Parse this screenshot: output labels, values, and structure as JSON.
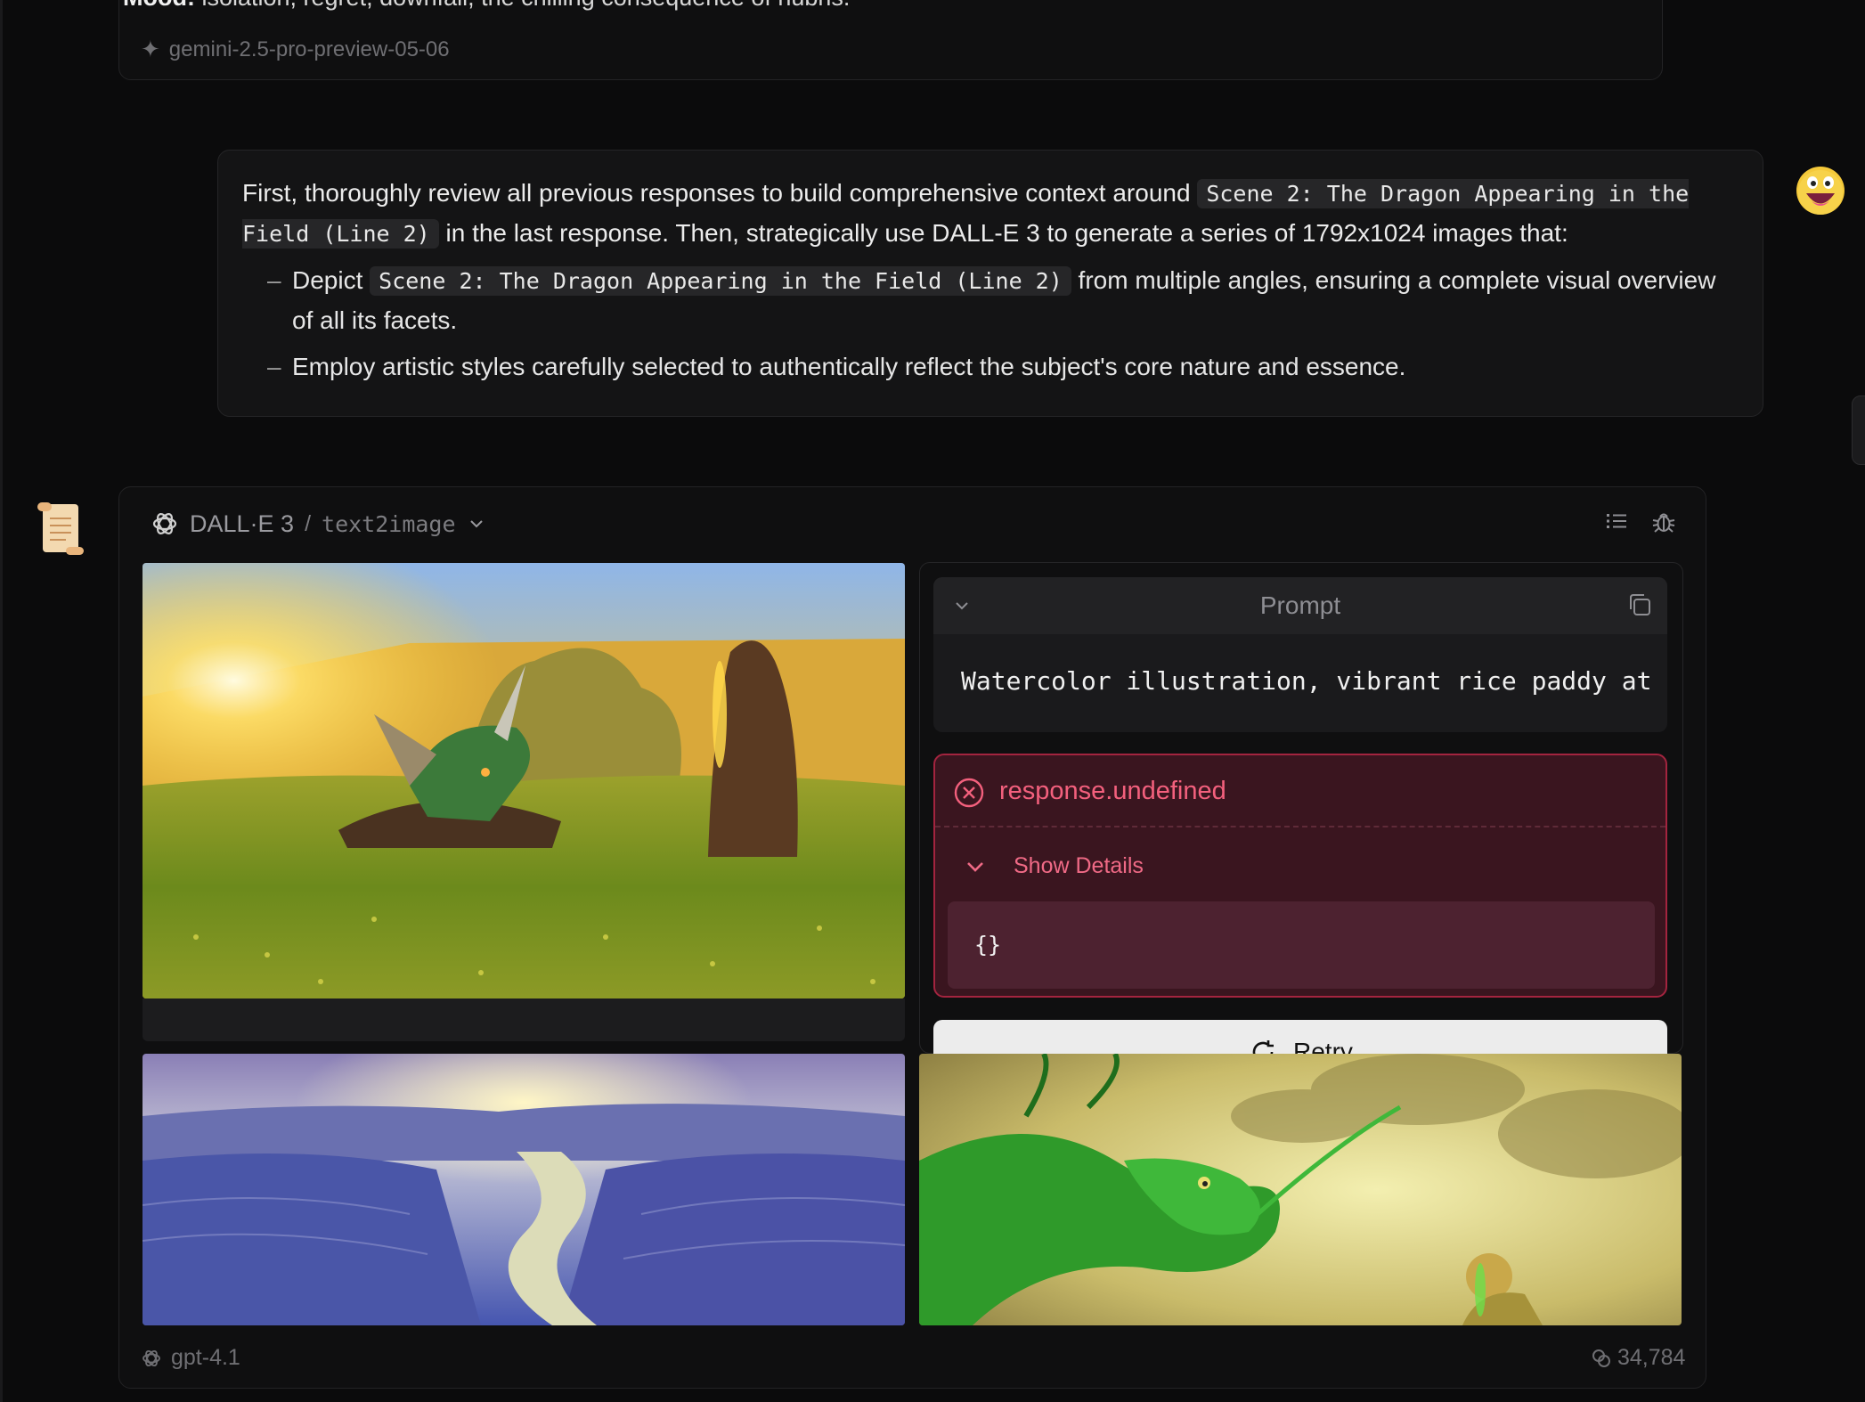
{
  "previous_message": {
    "text_bold": "Mood:",
    "text": " isolation, regret, downfall, the chilling consequence of hubris.",
    "model": "gemini-2.5-pro-preview-05-06"
  },
  "user_message": {
    "p1": "First, thoroughly review all previous responses to build comprehensive context around ",
    "code1": "Scene 2: The Dragon Appearing in the Field (Line 2)",
    "p2": " in the last response. Then, strategically use DALL-E 3 to generate a series of 1792x1024 images that:",
    "b1_pre": "Depict ",
    "b1_code": "Scene 2: The Dragon Appearing in the Field (Line 2)",
    "b1_post": " from multiple angles, ensuring a complete visual overview of all its facets.",
    "b2": "Employ artistic styles carefully selected to authentically reflect the subject's core nature and essence."
  },
  "plugin": {
    "title": "DALL·E 3",
    "separator": "/",
    "api": "text2image"
  },
  "prompt": {
    "title": "Prompt",
    "text": "Watercolor illustration, vibrant rice paddy at"
  },
  "error": {
    "title": "response.undefined",
    "details_label": "Show Details",
    "code": "{}"
  },
  "retry_label": "Retry",
  "footer": {
    "model": "gpt-4.1",
    "tokens": "34,784"
  },
  "icons": {
    "sparkle": "sparkle-icon",
    "user_avatar": "grinning-face-icon",
    "assistant_avatar": "scroll-icon",
    "openai": "openai-logo-icon",
    "chevron": "chevron-down-icon",
    "list": "list-icon",
    "bug": "bug-icon",
    "copy": "copy-icon",
    "error": "x-circle-icon",
    "retry": "refresh-icon",
    "tokens": "coins-icon"
  },
  "colors": {
    "background": "#0b0b0c",
    "error_text": "#f3607d",
    "error_bg": "#3a151f",
    "error_border": "#a3243f"
  }
}
